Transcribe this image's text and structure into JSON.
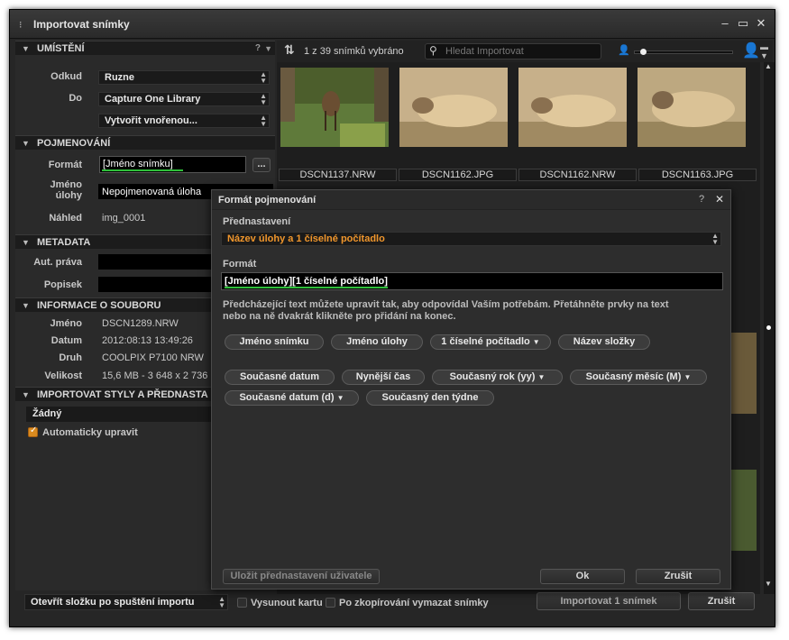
{
  "window": {
    "title": "Importovat snímky"
  },
  "sections": {
    "location": "UMÍSTĚNÍ",
    "naming": "POJMENOVÁNÍ",
    "metadata": "METADATA",
    "file_info": "INFORMACE O SOUBORU",
    "styles": "IMPORTOVAT STYLY A PŘEDNASTA"
  },
  "location": {
    "from_label": "Odkud",
    "from_value": "Ruzne",
    "to_label": "Do",
    "to_value": "Capture One Library",
    "subfolder_value": "Vytvořit vnořenou..."
  },
  "naming": {
    "format_label": "Formát",
    "format_value": "[Jméno snímku]",
    "format_button": "...",
    "job_label_1": "Jméno",
    "job_label_2": "úlohy",
    "job_value": "Nepojmenovaná úloha",
    "preview_label": "Náhled",
    "preview_value": "img_0001"
  },
  "metadata": {
    "copyright_label": "Aut. práva",
    "caption_label": "Popisek"
  },
  "file_info": {
    "name_label": "Jméno",
    "name_value": "DSCN1289.NRW",
    "date_label": "Datum",
    "date_value": "2012:08:13 13:49:26",
    "type_label": "Druh",
    "type_value": "COOLPIX P7100 NRW",
    "size_label": "Velikost",
    "size_value": "15,6 MB - 3 648 x 2 736"
  },
  "styles": {
    "preset_value": "Žádný",
    "auto_adjust_label": "Automaticky upravit",
    "auto_adjust_checked": true
  },
  "toolbar": {
    "selection_count": "1 z 39 snímků vybráno",
    "search_placeholder": "Hledat Importovat"
  },
  "thumbnails": [
    {
      "caption": "DSCN1137.NRW"
    },
    {
      "caption": "DSCN1162.JPG"
    },
    {
      "caption": "DSCN1162.NRW"
    },
    {
      "caption": "DSCN1163.JPG"
    }
  ],
  "footer": {
    "open_folder_value": "Otevřít složku po spuštění importu",
    "eject_label": "Vysunout kartu",
    "delete_after_label": "Po zkopírování vymazat snímky",
    "import_button": "Importovat 1 snímek",
    "cancel_button": "Zrušit"
  },
  "dialog": {
    "title": "Formát pojmenování",
    "help": "?",
    "preset_label": "Přednastavení",
    "preset_value": "Název úlohy a 1 číselné počítadlo",
    "format_label": "Formát",
    "format_token_1": "[Jméno úlohy]",
    "format_token_2": "[1 číselné počítadlo]",
    "help_line_1": "Předcházející text můžete upravit tak, aby odpovídal Vaším potřebám. Přetáhněte prvky na text",
    "help_line_2": "nebo na ně dvakrát klikněte pro přidání na konec.",
    "tokens": [
      "Jméno snímku",
      "Jméno úlohy",
      "1 číselné počítadlo",
      "Název složky",
      "Současné datum",
      "Nynější čas",
      "Současný rok (yy)",
      "Současný měsíc (M)",
      "Současné datum (d)",
      "Současný den týdne"
    ],
    "save_preset_button": "Uložit přednastavení uživatele",
    "ok_button": "Ok",
    "cancel_button": "Zrušit"
  },
  "colors": {
    "accent_orange": "#f0962c",
    "underline_green": "#2fbf3a"
  }
}
